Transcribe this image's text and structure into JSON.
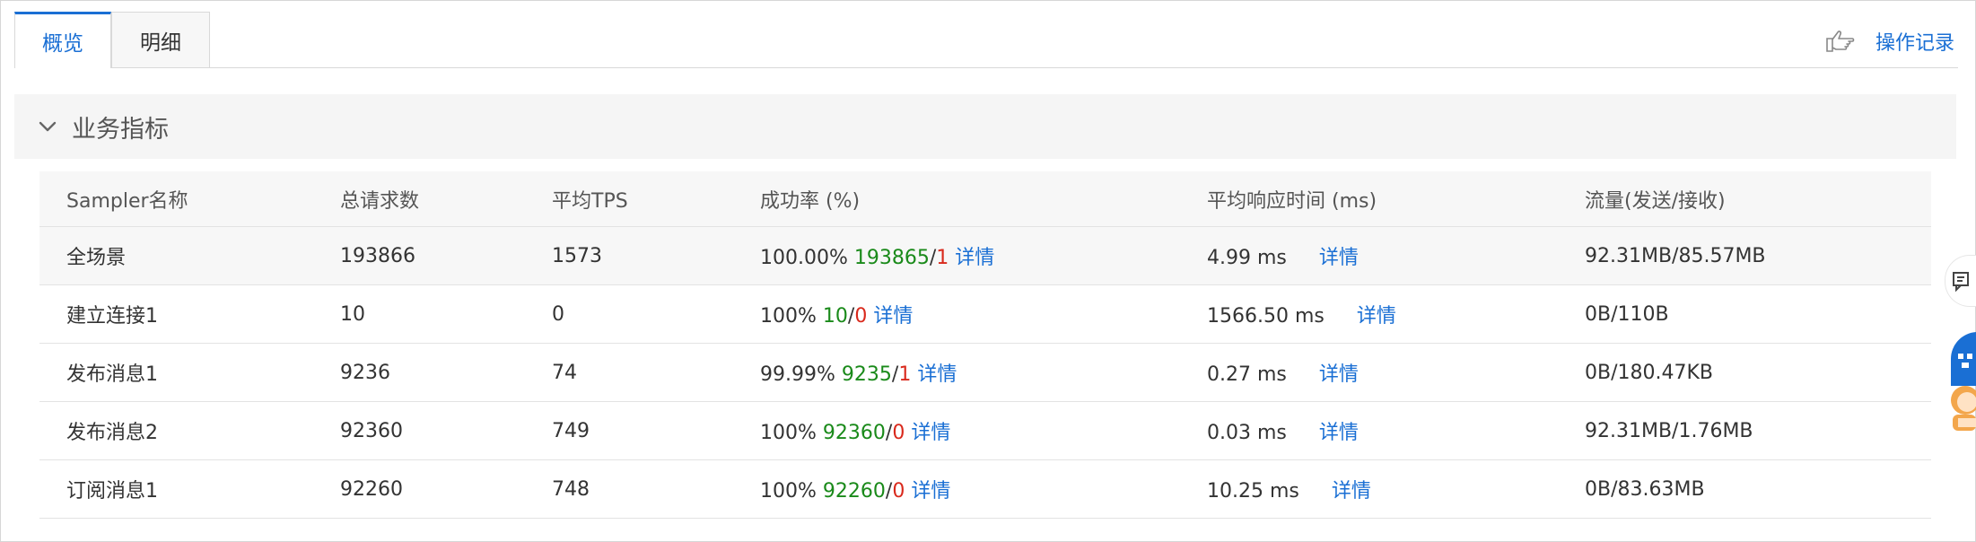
{
  "tabs": [
    {
      "label": "概览",
      "active": true
    },
    {
      "label": "明细",
      "active": false
    }
  ],
  "operation_log_label": "操作记录",
  "section": {
    "title": "业务指标"
  },
  "table": {
    "headers": [
      "Sampler名称",
      "总请求数",
      "平均TPS",
      "成功率 (%)",
      "平均响应时间 (ms)",
      "流量(发送/接收)"
    ],
    "rows": [
      {
        "name": "全场景",
        "requests": "193866",
        "tps": "1573",
        "rate": "100.00%",
        "success": "193865",
        "fail": "1",
        "detail": "详情",
        "resp": "4.99 ms",
        "resp_detail": "详情",
        "flow": "92.31MB/85.57MB"
      },
      {
        "name": "建立连接1",
        "requests": "10",
        "tps": "0",
        "rate": "100%",
        "success": "10",
        "fail": "0",
        "detail": "详情",
        "resp": "1566.50 ms",
        "resp_detail": "详情",
        "flow": "0B/110B"
      },
      {
        "name": "发布消息1",
        "requests": "9236",
        "tps": "74",
        "rate": "99.99%",
        "success": "9235",
        "fail": "1",
        "detail": "详情",
        "resp": "0.27 ms",
        "resp_detail": "详情",
        "flow": "0B/180.47KB"
      },
      {
        "name": "发布消息2",
        "requests": "92360",
        "tps": "749",
        "rate": "100%",
        "success": "92360",
        "fail": "0",
        "detail": "详情",
        "resp": "0.03 ms",
        "resp_detail": "详情",
        "flow": "92.31MB/1.76MB"
      },
      {
        "name": "订阅消息1",
        "requests": "92260",
        "tps": "748",
        "rate": "100%",
        "success": "92260",
        "fail": "0",
        "detail": "详情",
        "resp": "10.25 ms",
        "resp_detail": "详情",
        "flow": "0B/83.63MB"
      }
    ]
  },
  "icons": {
    "operation_log": "pointing-hand-icon",
    "collapse": "chevron-down-icon",
    "feedback": "chat-icon",
    "assistant": "robot-avatar-icon"
  },
  "colors": {
    "accent": "#1a6fd4",
    "success": "#1a8a1a",
    "error": "#d9291c"
  }
}
